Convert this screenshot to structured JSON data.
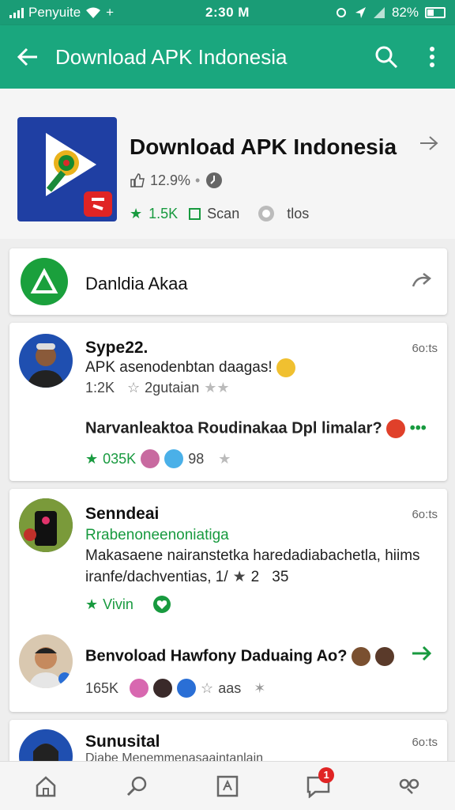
{
  "status": {
    "carrier": "Penyuite",
    "time": "2:30 M",
    "battery": "82%"
  },
  "appbar": {
    "title": "Download APK Indonesia"
  },
  "header": {
    "app_title": "Download APK Indonesia",
    "likes": "12.9%",
    "rating": "1.5K",
    "scan_label": "Scan",
    "tags_label": "tlos"
  },
  "download_card": {
    "label": "Danldia Akaa"
  },
  "posts": [
    {
      "name": "Sype22.",
      "time": "6o:ts",
      "text": "APK asenodenbtan daagas!",
      "count": "1:2K",
      "stars_label": "2gutaian",
      "question": "Narvanleaktoa Roudinakaa Dpl limalar?",
      "green_count": "035K",
      "reactions": "98"
    },
    {
      "name": "Senndeai",
      "time": "6o:ts",
      "subtitle": "Rrabenoneenoniatiga",
      "text1": "Makasaene nairanstetka haredadiabachetla, hiims",
      "text2": "iranfe/dachventias, 1/",
      "star_value": "2",
      "count": "35",
      "vote_label": "Vivin"
    },
    {
      "name": "Benvoload Hawfony Daduaing Ao?",
      "count": "165K",
      "star_label": "aas"
    },
    {
      "name": "Sunusital",
      "time": "6o:ts",
      "text": "Diabe Menemmenasaaintanlain"
    }
  ],
  "nav": {
    "notification_count": "1"
  },
  "colors": {
    "primary": "#1aa77e",
    "status": "#1a9c76",
    "accent_green": "#189a3f",
    "badge": "#e02424"
  }
}
